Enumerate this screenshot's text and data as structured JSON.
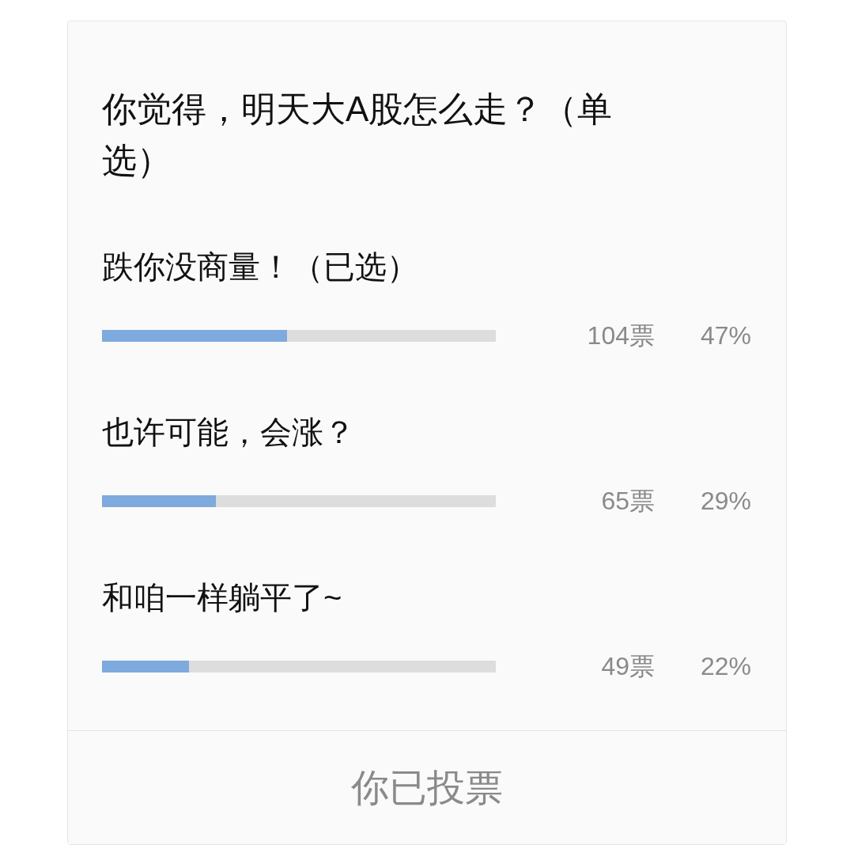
{
  "poll": {
    "question": "你觉得，明天大A股怎么走？（单选）",
    "options": [
      {
        "label": "跌你没商量！（已选）",
        "level": 0.47,
        "votes": "104票",
        "percent": "47%"
      },
      {
        "label": "也许可能，会涨？",
        "level": 0.29,
        "votes": "65票",
        "percent": "29%"
      },
      {
        "label": "和咱一样躺平了~",
        "level": 0.22,
        "votes": "49票",
        "percent": "22%"
      }
    ],
    "footer": {
      "label": "你已投票",
      "disabled": true
    }
  }
}
